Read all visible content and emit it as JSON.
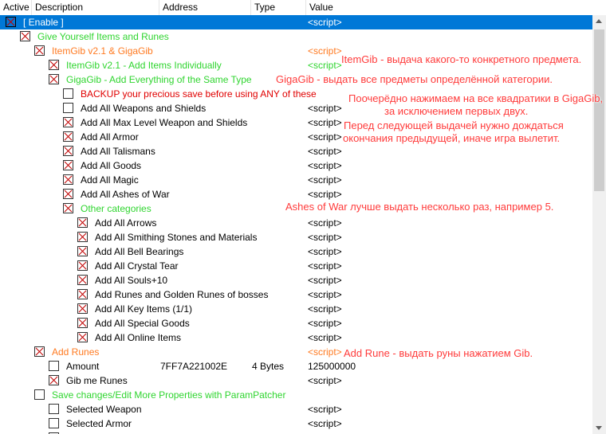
{
  "header": {
    "active": "Active",
    "description": "Description",
    "address": "Address",
    "type": "Type",
    "value": "Value"
  },
  "rows": [
    {
      "desc": "[ Enable ]",
      "value": "<script>",
      "address": "",
      "type": "",
      "checked": true,
      "indent": 0,
      "dcolor": "white",
      "vcolor": "white",
      "selected": true
    },
    {
      "desc": "Give Yourself Items and Runes",
      "value": "",
      "address": "",
      "type": "",
      "checked": true,
      "indent": 1,
      "dcolor": "green",
      "vcolor": "black",
      "selected": false
    },
    {
      "desc": "ItemGib v2.1 & GigaGib",
      "value": "<script>",
      "address": "",
      "type": "",
      "checked": true,
      "indent": 2,
      "dcolor": "orange",
      "vcolor": "orange",
      "selected": false
    },
    {
      "desc": "ItemGib v2.1 - Add Items Individually",
      "value": "<script>",
      "address": "",
      "type": "",
      "checked": true,
      "indent": 3,
      "dcolor": "green",
      "vcolor": "green",
      "selected": false
    },
    {
      "desc": "GigaGib - Add Everything of the Same Type",
      "value": "",
      "address": "",
      "type": "",
      "checked": true,
      "indent": 3,
      "dcolor": "green",
      "vcolor": "black",
      "selected": false
    },
    {
      "desc": "BACKUP your precious save before using ANY of these",
      "value": "",
      "address": "",
      "type": "",
      "checked": false,
      "indent": 4,
      "dcolor": "red",
      "vcolor": "black",
      "selected": false
    },
    {
      "desc": "Add All Weapons and Shields",
      "value": "<script>",
      "address": "",
      "type": "",
      "checked": false,
      "indent": 4,
      "dcolor": "black",
      "vcolor": "black",
      "selected": false
    },
    {
      "desc": "Add All Max Level Weapon and Shields",
      "value": "<script>",
      "address": "",
      "type": "",
      "checked": true,
      "indent": 4,
      "dcolor": "black",
      "vcolor": "black",
      "selected": false
    },
    {
      "desc": "Add All Armor",
      "value": "<script>",
      "address": "",
      "type": "",
      "checked": true,
      "indent": 4,
      "dcolor": "black",
      "vcolor": "black",
      "selected": false
    },
    {
      "desc": "Add All Talismans",
      "value": "<script>",
      "address": "",
      "type": "",
      "checked": true,
      "indent": 4,
      "dcolor": "black",
      "vcolor": "black",
      "selected": false
    },
    {
      "desc": "Add All Goods",
      "value": "<script>",
      "address": "",
      "type": "",
      "checked": true,
      "indent": 4,
      "dcolor": "black",
      "vcolor": "black",
      "selected": false
    },
    {
      "desc": "Add All Magic",
      "value": "<script>",
      "address": "",
      "type": "",
      "checked": true,
      "indent": 4,
      "dcolor": "black",
      "vcolor": "black",
      "selected": false
    },
    {
      "desc": "Add All Ashes of War",
      "value": "<script>",
      "address": "",
      "type": "",
      "checked": true,
      "indent": 4,
      "dcolor": "black",
      "vcolor": "black",
      "selected": false
    },
    {
      "desc": "Other categories",
      "value": "",
      "address": "",
      "type": "",
      "checked": true,
      "indent": 4,
      "dcolor": "green",
      "vcolor": "black",
      "selected": false
    },
    {
      "desc": "Add All Arrows",
      "value": "<script>",
      "address": "",
      "type": "",
      "checked": true,
      "indent": 5,
      "dcolor": "black",
      "vcolor": "black",
      "selected": false
    },
    {
      "desc": "Add All Smithing Stones and Materials",
      "value": "<script>",
      "address": "",
      "type": "",
      "checked": true,
      "indent": 5,
      "dcolor": "black",
      "vcolor": "black",
      "selected": false
    },
    {
      "desc": "Add All Bell Bearings",
      "value": "<script>",
      "address": "",
      "type": "",
      "checked": true,
      "indent": 5,
      "dcolor": "black",
      "vcolor": "black",
      "selected": false
    },
    {
      "desc": "Add All Crystal Tear",
      "value": "<script>",
      "address": "",
      "type": "",
      "checked": true,
      "indent": 5,
      "dcolor": "black",
      "vcolor": "black",
      "selected": false
    },
    {
      "desc": "Add All Souls+10",
      "value": "<script>",
      "address": "",
      "type": "",
      "checked": true,
      "indent": 5,
      "dcolor": "black",
      "vcolor": "black",
      "selected": false
    },
    {
      "desc": "Add Runes and Golden Runes of bosses",
      "value": "<script>",
      "address": "",
      "type": "",
      "checked": true,
      "indent": 5,
      "dcolor": "black",
      "vcolor": "black",
      "selected": false
    },
    {
      "desc": "Add All Key Items (1/1)",
      "value": "<script>",
      "address": "",
      "type": "",
      "checked": true,
      "indent": 5,
      "dcolor": "black",
      "vcolor": "black",
      "selected": false
    },
    {
      "desc": "Add All Special Goods",
      "value": "<script>",
      "address": "",
      "type": "",
      "checked": true,
      "indent": 5,
      "dcolor": "black",
      "vcolor": "black",
      "selected": false
    },
    {
      "desc": "Add All Online Items",
      "value": "<script>",
      "address": "",
      "type": "",
      "checked": true,
      "indent": 5,
      "dcolor": "black",
      "vcolor": "black",
      "selected": false
    },
    {
      "desc": "Add Runes",
      "value": "<script>",
      "address": "",
      "type": "",
      "checked": true,
      "indent": 2,
      "dcolor": "orange",
      "vcolor": "orange",
      "selected": false
    },
    {
      "desc": "Amount",
      "value": "125000000",
      "address": "7FF7A221002E",
      "type": "4 Bytes",
      "checked": false,
      "indent": 3,
      "dcolor": "black",
      "vcolor": "black",
      "selected": false
    },
    {
      "desc": "Gib me Runes",
      "value": "<script>",
      "address": "",
      "type": "",
      "checked": true,
      "indent": 3,
      "dcolor": "black",
      "vcolor": "black",
      "selected": false
    },
    {
      "desc": "Save changes/Edit More Properties with ParamPatcher",
      "value": "",
      "address": "",
      "type": "",
      "checked": false,
      "indent": 2,
      "dcolor": "green",
      "vcolor": "black",
      "selected": false
    },
    {
      "desc": "Selected Weapon",
      "value": "<script>",
      "address": "",
      "type": "",
      "checked": false,
      "indent": 3,
      "dcolor": "black",
      "vcolor": "black",
      "selected": false
    },
    {
      "desc": "Selected Armor",
      "value": "<script>",
      "address": "",
      "type": "",
      "checked": false,
      "indent": 3,
      "dcolor": "black",
      "vcolor": "black",
      "selected": false
    },
    {
      "desc": "",
      "value": "",
      "address": "",
      "type": "",
      "checked": false,
      "indent": 3,
      "dcolor": "black",
      "vcolor": "black",
      "selected": false
    }
  ],
  "annotations": [
    "ItemGib - выдача какого-то конкретного предмета.",
    "GigaGib - выдать все предметы определённой категории.",
    "Поочерёдно нажимаем на все квадратики в GigaGib,",
    "за исключением первых двух.",
    "Перед следующей выдачей нужно дождаться",
    "окончания предыдущей, иначе игра вылетит.",
    "Ashes of War лучше выдать несколько раз, например 5.",
    "Add Rune - выдать руны нажатием Gib."
  ]
}
